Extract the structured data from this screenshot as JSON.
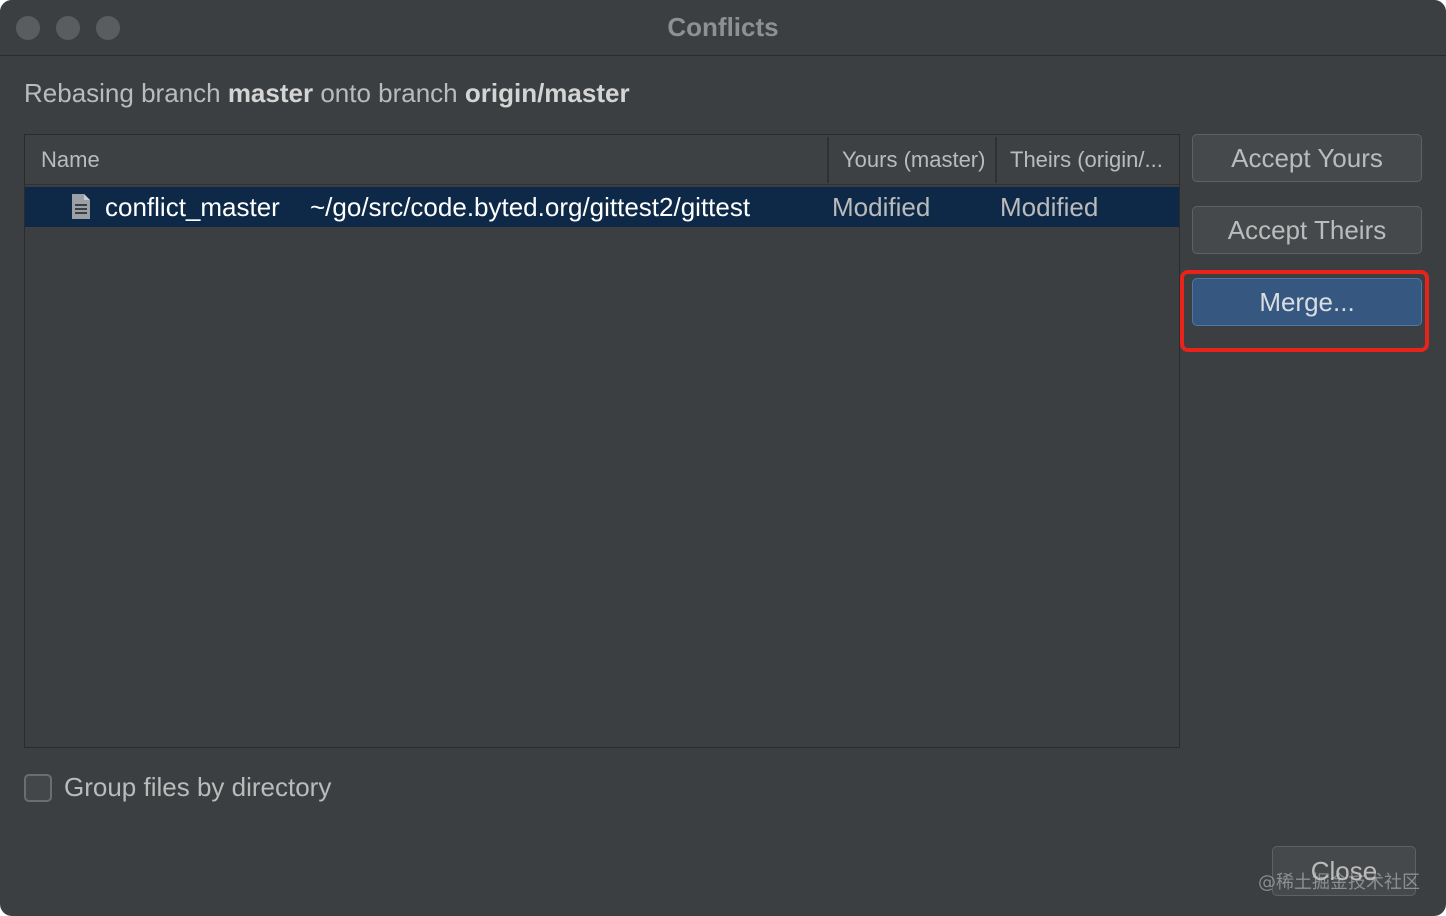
{
  "window": {
    "title": "Conflicts"
  },
  "header": {
    "prefix": "Rebasing branch ",
    "branch": "master",
    "middle": " onto branch ",
    "target_branch": "origin/master"
  },
  "table": {
    "columns": {
      "name": "Name",
      "yours": "Yours (master)",
      "theirs": "Theirs (origin/..."
    },
    "rows": [
      {
        "icon": "file-icon",
        "name": "conflict_master",
        "path": "~/go/src/code.byted.org/gittest2/gittest",
        "yours": "Modified",
        "theirs": "Modified"
      }
    ]
  },
  "actions": {
    "accept_yours": "Accept Yours",
    "accept_theirs": "Accept Theirs",
    "merge": "Merge..."
  },
  "options": {
    "group_by_directory": "Group files by directory",
    "group_by_directory_checked": false
  },
  "footer": {
    "close": "Close",
    "watermark": "@稀土掘金技术社区"
  },
  "colors": {
    "background": "#3c3f41",
    "selection": "#0d2947",
    "primary_button": "#365880",
    "highlight": "#e8231c"
  }
}
